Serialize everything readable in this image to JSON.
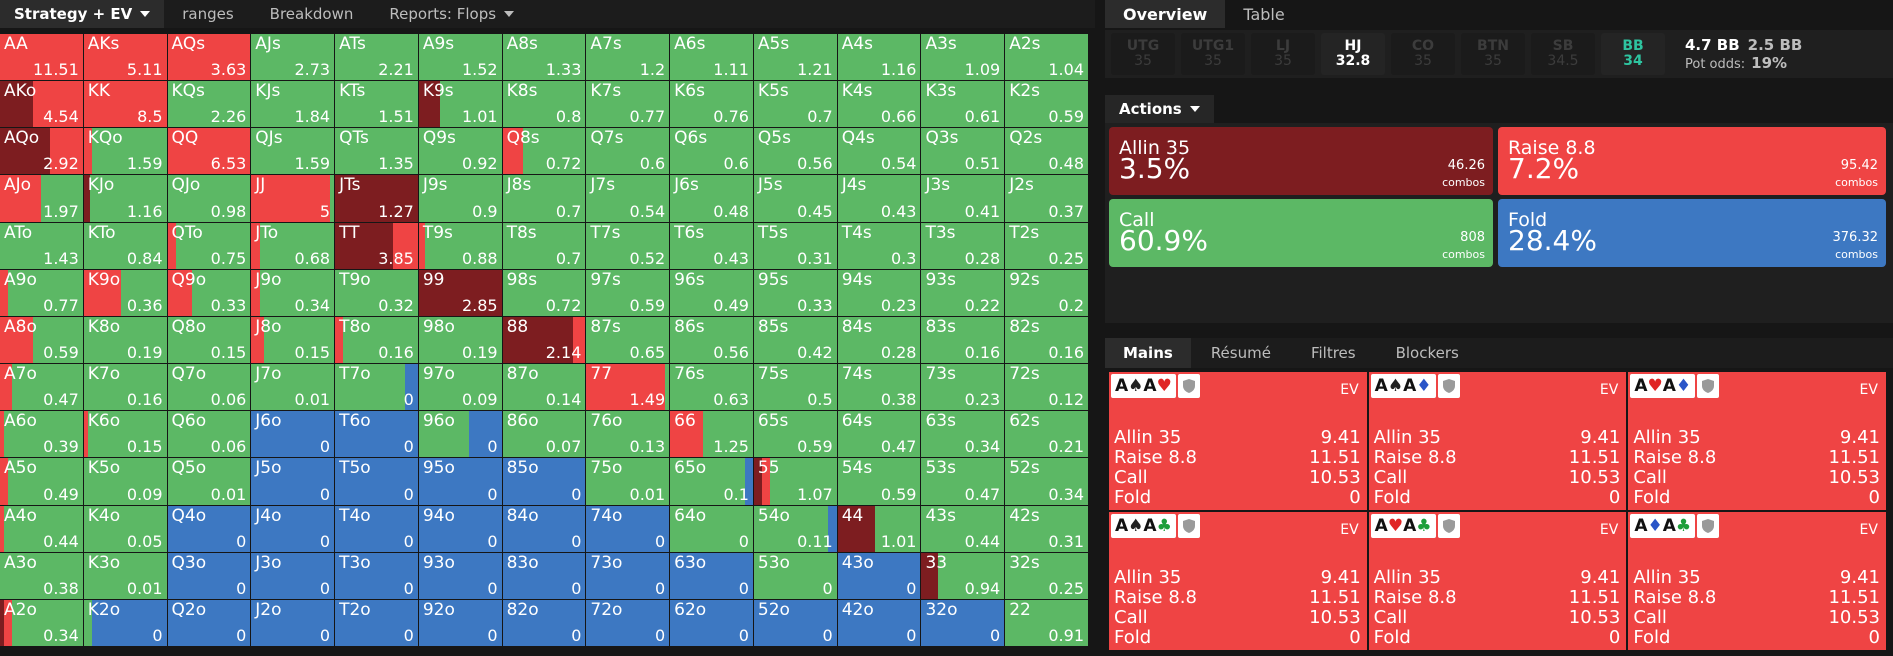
{
  "nav": {
    "tabs": [
      {
        "label": "Strategy + EV",
        "dropdown": true,
        "active": true
      },
      {
        "label": "ranges"
      },
      {
        "label": "Breakdown"
      },
      {
        "label": "Reports: Flops",
        "dropdown": true
      }
    ],
    "view_icons": [
      "color-mode-icon",
      "compact-grid-icon",
      "grid-icon",
      "square-view-icon"
    ]
  },
  "colors": {
    "allin": "#7d1d20",
    "raise": "#ef4444",
    "call": "#5cb865",
    "fold": "#3d78c2"
  },
  "grid": [
    [
      [
        "AA",
        "11.51",
        "r"
      ],
      [
        "AKs",
        "5.11",
        "r"
      ],
      [
        "AQs",
        "3.63",
        "r"
      ],
      [
        "AJs",
        "2.73",
        "c"
      ],
      [
        "ATs",
        "2.21",
        "c"
      ],
      [
        "A9s",
        "1.52",
        "c"
      ],
      [
        "A8s",
        "1.33",
        "c"
      ],
      [
        "A7s",
        "1.2",
        "c"
      ],
      [
        "A6s",
        "1.11",
        "c"
      ],
      [
        "A5s",
        "1.21",
        "c"
      ],
      [
        "A4s",
        "1.16",
        "c"
      ],
      [
        "A3s",
        "1.09",
        "c"
      ],
      [
        "A2s",
        "1.04",
        "c"
      ]
    ],
    [
      [
        "AKo",
        "4.54",
        "a40r"
      ],
      [
        "KK",
        "8.5",
        "r"
      ],
      [
        "KQs",
        "2.26",
        "c"
      ],
      [
        "KJs",
        "1.84",
        "c"
      ],
      [
        "KTs",
        "1.51",
        "c"
      ],
      [
        "K9s",
        "1.01",
        "a25c"
      ],
      [
        "K8s",
        "0.8",
        "c"
      ],
      [
        "K7s",
        "0.77",
        "c"
      ],
      [
        "K6s",
        "0.76",
        "c"
      ],
      [
        "K5s",
        "0.7",
        "c"
      ],
      [
        "K4s",
        "0.66",
        "c"
      ],
      [
        "K3s",
        "0.61",
        "c"
      ],
      [
        "K2s",
        "0.59",
        "c"
      ]
    ],
    [
      [
        "AQo",
        "2.92",
        "a60r"
      ],
      [
        "KQo",
        "1.59",
        "r10c"
      ],
      [
        "QQ",
        "6.53",
        "r"
      ],
      [
        "QJs",
        "1.59",
        "c"
      ],
      [
        "QTs",
        "1.35",
        "c"
      ],
      [
        "Q9s",
        "0.92",
        "c"
      ],
      [
        "Q8s",
        "0.72",
        "r25c"
      ],
      [
        "Q7s",
        "0.6",
        "c"
      ],
      [
        "Q6s",
        "0.6",
        "c"
      ],
      [
        "Q5s",
        "0.56",
        "c"
      ],
      [
        "Q4s",
        "0.54",
        "c"
      ],
      [
        "Q3s",
        "0.51",
        "c"
      ],
      [
        "Q2s",
        "0.48",
        "c"
      ]
    ],
    [
      [
        "AJo",
        "1.97",
        "r50c"
      ],
      [
        "KJo",
        "1.16",
        "a8c"
      ],
      [
        "QJo",
        "0.98",
        "c"
      ],
      [
        "JJ",
        "5",
        "r95c"
      ],
      [
        "JTs",
        "1.27",
        "a"
      ],
      [
        "J9s",
        "0.9",
        "c"
      ],
      [
        "J8s",
        "0.7",
        "c"
      ],
      [
        "J7s",
        "0.54",
        "c"
      ],
      [
        "J6s",
        "0.48",
        "c"
      ],
      [
        "J5s",
        "0.45",
        "c"
      ],
      [
        "J4s",
        "0.43",
        "c"
      ],
      [
        "J3s",
        "0.41",
        "c"
      ],
      [
        "J2s",
        "0.37",
        "c"
      ]
    ],
    [
      [
        "ATo",
        "1.43",
        "c"
      ],
      [
        "KTo",
        "0.84",
        "c"
      ],
      [
        "QTo",
        "0.75",
        "r10c"
      ],
      [
        "JTo",
        "0.68",
        "r10c"
      ],
      [
        "TT",
        "3.85",
        "a70r"
      ],
      [
        "T9s",
        "0.88",
        "r8c"
      ],
      [
        "T8s",
        "0.7",
        "c"
      ],
      [
        "T7s",
        "0.52",
        "c"
      ],
      [
        "T6s",
        "0.43",
        "c"
      ],
      [
        "T5s",
        "0.31",
        "c"
      ],
      [
        "T4s",
        "0.3",
        "c"
      ],
      [
        "T3s",
        "0.28",
        "c"
      ],
      [
        "T2s",
        "0.25",
        "c"
      ]
    ],
    [
      [
        "A9o",
        "0.77",
        "r10c"
      ],
      [
        "K9o",
        "0.36",
        "r45c"
      ],
      [
        "Q9o",
        "0.33",
        "r30c"
      ],
      [
        "J9o",
        "0.34",
        "r10c"
      ],
      [
        "T9o",
        "0.32",
        "c"
      ],
      [
        "99",
        "2.85",
        "a"
      ],
      [
        "98s",
        "0.72",
        "c"
      ],
      [
        "97s",
        "0.59",
        "c"
      ],
      [
        "96s",
        "0.49",
        "c"
      ],
      [
        "95s",
        "0.33",
        "c"
      ],
      [
        "94s",
        "0.23",
        "c"
      ],
      [
        "93s",
        "0.22",
        "c"
      ],
      [
        "92s",
        "0.2",
        "c"
      ]
    ],
    [
      [
        "A8o",
        "0.59",
        "r40c"
      ],
      [
        "K8o",
        "0.19",
        "c"
      ],
      [
        "Q8o",
        "0.15",
        "c"
      ],
      [
        "J8o",
        "0.15",
        "r15c"
      ],
      [
        "T8o",
        "0.16",
        "r10c"
      ],
      [
        "98o",
        "0.19",
        "c"
      ],
      [
        "88",
        "2.14",
        "a85r"
      ],
      [
        "87s",
        "0.65",
        "c"
      ],
      [
        "86s",
        "0.56",
        "c"
      ],
      [
        "85s",
        "0.42",
        "c"
      ],
      [
        "84s",
        "0.28",
        "c"
      ],
      [
        "83s",
        "0.16",
        "c"
      ],
      [
        "82s",
        "0.16",
        "c"
      ]
    ],
    [
      [
        "A7o",
        "0.47",
        "r15c"
      ],
      [
        "K7o",
        "0.16",
        "c"
      ],
      [
        "Q7o",
        "0.06",
        "c"
      ],
      [
        "J7o",
        "0.01",
        "c"
      ],
      [
        "T7o",
        "0",
        "c85f"
      ],
      [
        "97o",
        "0.09",
        "c"
      ],
      [
        "87o",
        "0.14",
        "c"
      ],
      [
        "77",
        "1.49",
        "r95c"
      ],
      [
        "76s",
        "0.63",
        "c"
      ],
      [
        "75s",
        "0.5",
        "c"
      ],
      [
        "74s",
        "0.38",
        "c"
      ],
      [
        "73s",
        "0.23",
        "c"
      ],
      [
        "72s",
        "0.12",
        "c"
      ]
    ],
    [
      [
        "A6o",
        "0.39",
        "r5c"
      ],
      [
        "K6o",
        "0.15",
        "r5c"
      ],
      [
        "Q6o",
        "0.06",
        "c"
      ],
      [
        "J6o",
        "0",
        "f"
      ],
      [
        "T6o",
        "0",
        "f"
      ],
      [
        "96o",
        "0",
        "c60f"
      ],
      [
        "86o",
        "0.07",
        "c"
      ],
      [
        "76o",
        "0.13",
        "c"
      ],
      [
        "66",
        "1.25",
        "r40c"
      ],
      [
        "65s",
        "0.59",
        "c"
      ],
      [
        "64s",
        "0.47",
        "c"
      ],
      [
        "63s",
        "0.34",
        "c"
      ],
      [
        "62s",
        "0.21",
        "c"
      ]
    ],
    [
      [
        "A5o",
        "0.49",
        "r10c"
      ],
      [
        "K5o",
        "0.09",
        "c"
      ],
      [
        "Q5o",
        "0.01",
        "c"
      ],
      [
        "J5o",
        "0",
        "f"
      ],
      [
        "T5o",
        "0",
        "f"
      ],
      [
        "95o",
        "0",
        "f"
      ],
      [
        "85o",
        "0",
        "f"
      ],
      [
        "75o",
        "0.01",
        "c"
      ],
      [
        "65o",
        "0.1",
        "c90f"
      ],
      [
        "55",
        "1.07",
        "a10r10c"
      ],
      [
        "54s",
        "0.59",
        "c"
      ],
      [
        "53s",
        "0.47",
        "c"
      ],
      [
        "52s",
        "0.34",
        "c"
      ]
    ],
    [
      [
        "A4o",
        "0.44",
        "r5c"
      ],
      [
        "K4o",
        "0.05",
        "c"
      ],
      [
        "Q4o",
        "0",
        "f"
      ],
      [
        "J4o",
        "0",
        "f"
      ],
      [
        "T4o",
        "0",
        "f"
      ],
      [
        "94o",
        "0",
        "f"
      ],
      [
        "84o",
        "0",
        "f"
      ],
      [
        "74o",
        "0",
        "f"
      ],
      [
        "64o",
        "0",
        "c"
      ],
      [
        "54o",
        "0.11",
        "c90f"
      ],
      [
        "44",
        "1.01",
        "a45c"
      ],
      [
        "43s",
        "0.44",
        "c"
      ],
      [
        "42s",
        "0.31",
        "c"
      ]
    ],
    [
      [
        "A3o",
        "0.38",
        "c"
      ],
      [
        "K3o",
        "0.01",
        "c"
      ],
      [
        "Q3o",
        "0",
        "f"
      ],
      [
        "J3o",
        "0",
        "f"
      ],
      [
        "T3o",
        "0",
        "f"
      ],
      [
        "93o",
        "0",
        "f"
      ],
      [
        "83o",
        "0",
        "f"
      ],
      [
        "73o",
        "0",
        "f"
      ],
      [
        "63o",
        "0",
        "f"
      ],
      [
        "53o",
        "0",
        "c"
      ],
      [
        "43o",
        "0",
        "f"
      ],
      [
        "33",
        "0.94",
        "a20c"
      ],
      [
        "32s",
        "0.25",
        "c"
      ]
    ],
    [
      [
        "A2o",
        "0.34",
        "a5r10c"
      ],
      [
        "K2o",
        "0",
        "c10f"
      ],
      [
        "Q2o",
        "0",
        "f"
      ],
      [
        "J2o",
        "0",
        "f"
      ],
      [
        "T2o",
        "0",
        "f"
      ],
      [
        "92o",
        "0",
        "f"
      ],
      [
        "82o",
        "0",
        "f"
      ],
      [
        "72o",
        "0",
        "f"
      ],
      [
        "62o",
        "0",
        "f"
      ],
      [
        "52o",
        "0",
        "f"
      ],
      [
        "42o",
        "0",
        "f"
      ],
      [
        "32o",
        "0",
        "f"
      ],
      [
        "22",
        "0.91",
        "c"
      ]
    ]
  ],
  "right_tabs": [
    {
      "label": "Overview",
      "active": true
    },
    {
      "label": "Table"
    }
  ],
  "positions": [
    {
      "name": "UTG",
      "value": "35"
    },
    {
      "name": "UTG1",
      "value": "35"
    },
    {
      "name": "LJ",
      "value": "35"
    },
    {
      "name": "HJ",
      "value": "32.8",
      "state": "active"
    },
    {
      "name": "CO",
      "value": "35"
    },
    {
      "name": "BTN",
      "value": "35"
    },
    {
      "name": "SB",
      "value": "34.5"
    },
    {
      "name": "BB",
      "value": "34",
      "state": "hero"
    }
  ],
  "pot": {
    "bb1": "4.7 BB",
    "bb2": "2.5 BB",
    "odds_label": "Pot odds:",
    "odds_value": "19%"
  },
  "actions_header": "Actions",
  "actions": [
    {
      "key": "allin",
      "name": "Allin 35",
      "pct": "3.5%",
      "combos": "46.26",
      "combos_label": "combos",
      "freq": 3.5
    },
    {
      "key": "raise",
      "name": "Raise 8.8",
      "pct": "7.2%",
      "combos": "95.42",
      "combos_label": "combos",
      "freq": 7.2
    },
    {
      "key": "call",
      "name": "Call",
      "pct": "60.9%",
      "combos": "808",
      "combos_label": "combos",
      "freq": 60.9
    },
    {
      "key": "fold",
      "name": "Fold",
      "pct": "28.4%",
      "combos": "376.32",
      "combos_label": "combos",
      "freq": 28.4
    }
  ],
  "bottom_tabs": [
    {
      "label": "Mains",
      "active": true
    },
    {
      "label": "Résumé"
    },
    {
      "label": "Filtres"
    },
    {
      "label": "Blockers"
    }
  ],
  "combos": [
    {
      "cards": [
        [
          "A",
          "♠",
          "#222"
        ],
        [
          "A",
          "♥",
          "#e02424"
        ]
      ],
      "ev_label": "EV",
      "lines": [
        [
          "Allin 35",
          "9.41"
        ],
        [
          "Raise 8.8",
          "11.51"
        ],
        [
          "Call",
          "10.53"
        ],
        [
          "Fold",
          "0"
        ]
      ]
    },
    {
      "cards": [
        [
          "A",
          "♠",
          "#222"
        ],
        [
          "A",
          "♦",
          "#2a55c8"
        ]
      ],
      "ev_label": "EV",
      "lines": [
        [
          "Allin 35",
          "9.41"
        ],
        [
          "Raise 8.8",
          "11.51"
        ],
        [
          "Call",
          "10.53"
        ],
        [
          "Fold",
          "0"
        ]
      ]
    },
    {
      "cards": [
        [
          "A",
          "♥",
          "#e02424"
        ],
        [
          "A",
          "♦",
          "#2a55c8"
        ]
      ],
      "ev_label": "EV",
      "lines": [
        [
          "Allin 35",
          "9.41"
        ],
        [
          "Raise 8.8",
          "11.51"
        ],
        [
          "Call",
          "10.53"
        ],
        [
          "Fold",
          "0"
        ]
      ]
    },
    {
      "cards": [
        [
          "A",
          "♠",
          "#222"
        ],
        [
          "A",
          "♣",
          "#1e9e3a"
        ]
      ],
      "ev_label": "EV",
      "lines": [
        [
          "Allin 35",
          "9.41"
        ],
        [
          "Raise 8.8",
          "11.51"
        ],
        [
          "Call",
          "10.53"
        ],
        [
          "Fold",
          "0"
        ]
      ]
    },
    {
      "cards": [
        [
          "A",
          "♥",
          "#e02424"
        ],
        [
          "A",
          "♣",
          "#1e9e3a"
        ]
      ],
      "ev_label": "EV",
      "lines": [
        [
          "Allin 35",
          "9.41"
        ],
        [
          "Raise 8.8",
          "11.51"
        ],
        [
          "Call",
          "10.53"
        ],
        [
          "Fold",
          "0"
        ]
      ]
    },
    {
      "cards": [
        [
          "A",
          "♦",
          "#2a55c8"
        ],
        [
          "A",
          "♣",
          "#1e9e3a"
        ]
      ],
      "ev_label": "EV",
      "lines": [
        [
          "Allin 35",
          "9.41"
        ],
        [
          "Raise 8.8",
          "11.51"
        ],
        [
          "Call",
          "10.53"
        ],
        [
          "Fold",
          "0"
        ]
      ]
    }
  ]
}
